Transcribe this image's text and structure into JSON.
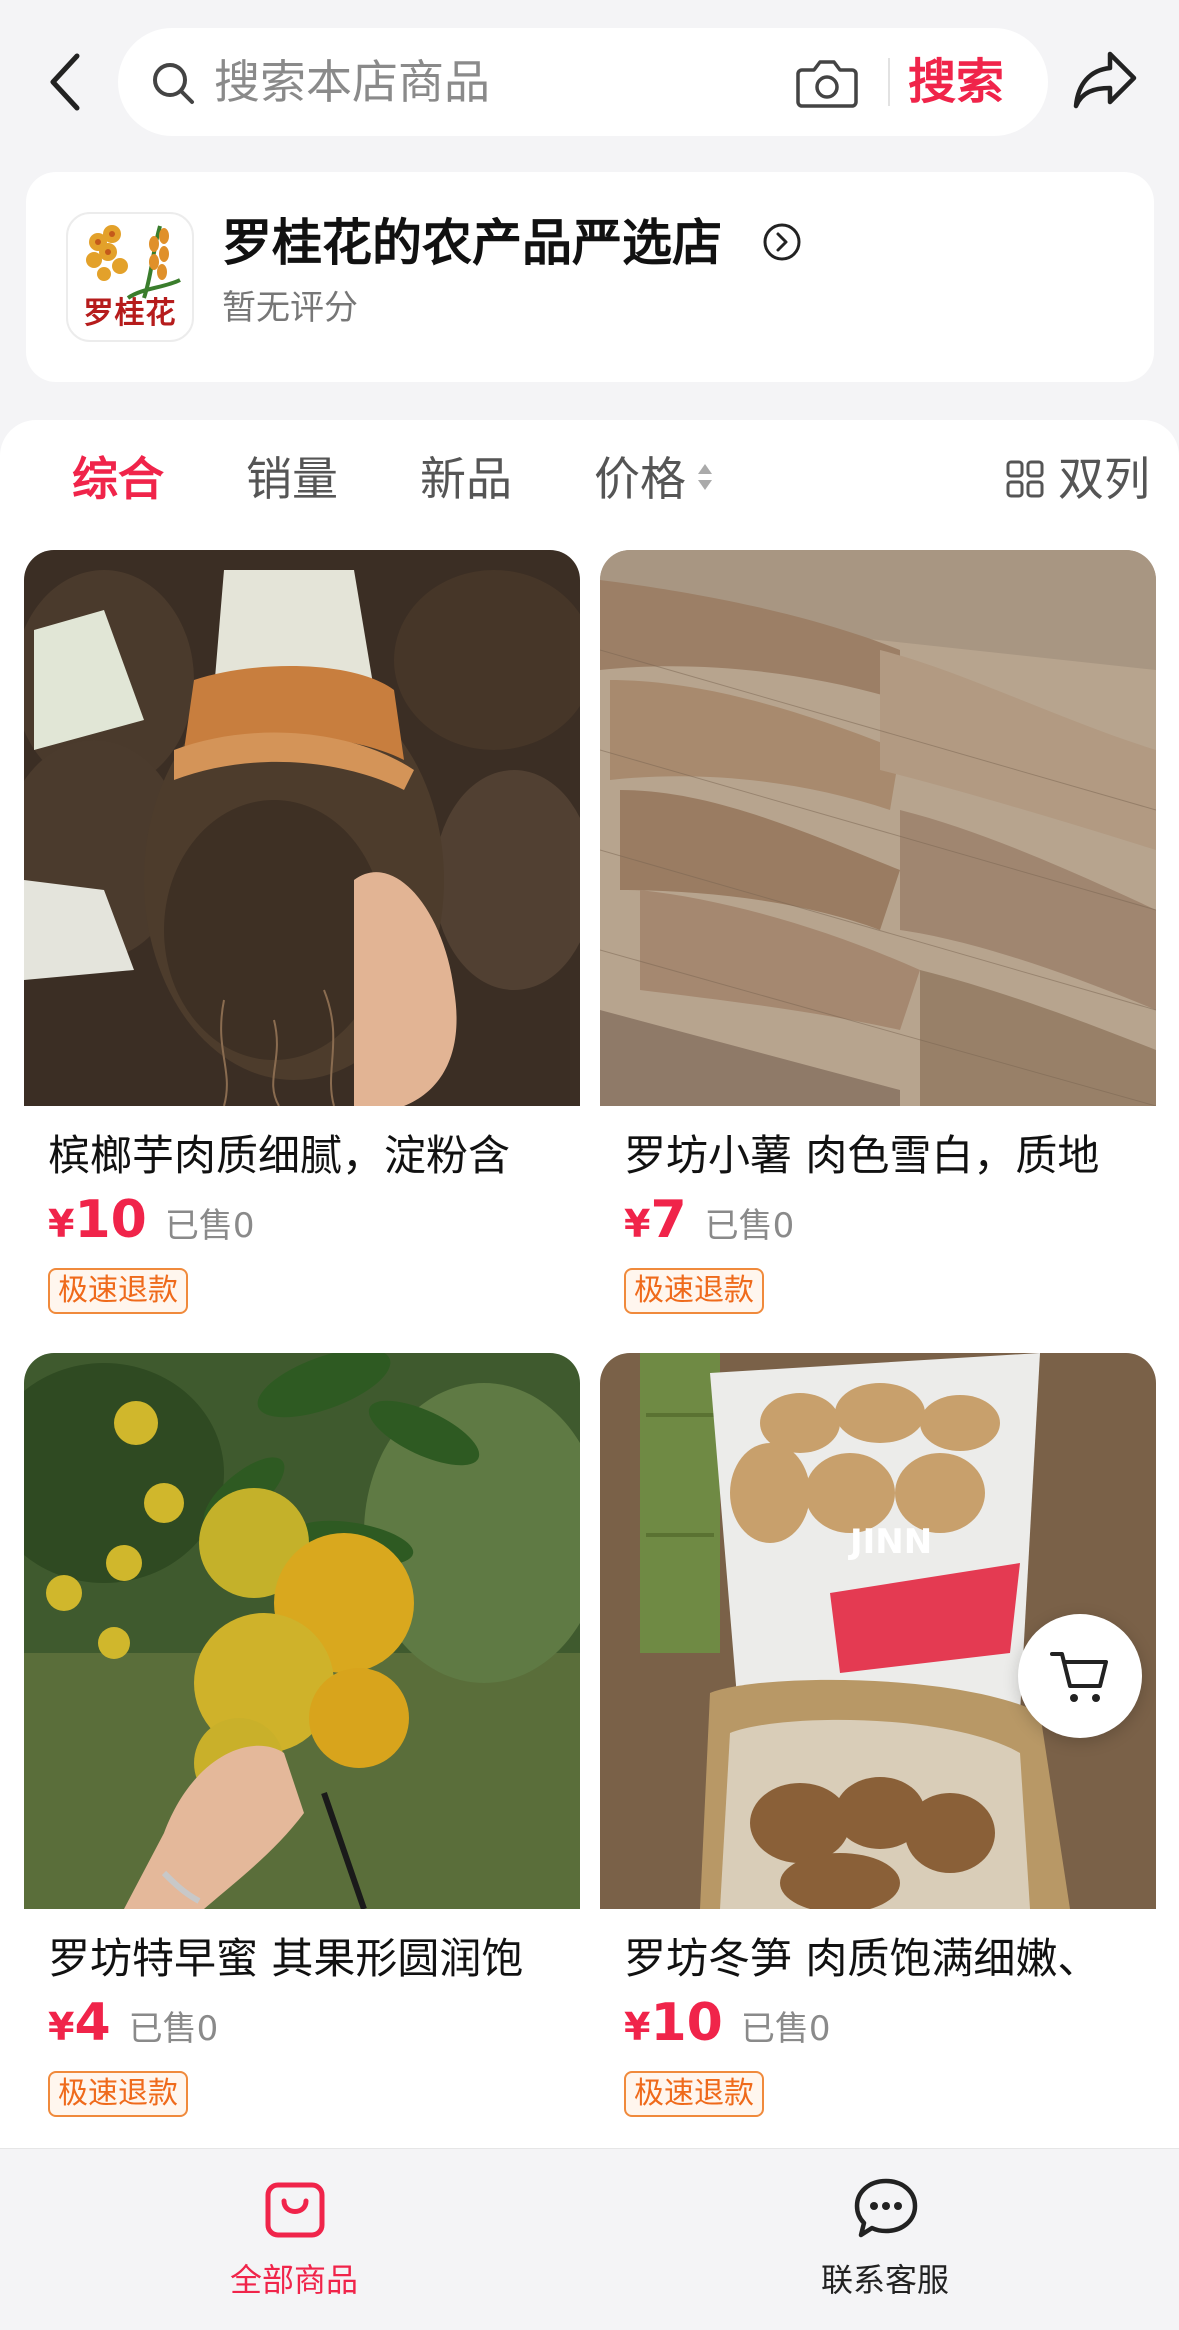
{
  "search": {
    "placeholder": "搜索本店商品",
    "button_label": "搜索"
  },
  "shop": {
    "name": "罗桂花的农产品严选店",
    "rating": "暂无评分",
    "logo_text": "罗桂花"
  },
  "sort_tabs": [
    {
      "label": "综合",
      "active": true
    },
    {
      "label": "销量",
      "active": false
    },
    {
      "label": "新品",
      "active": false
    },
    {
      "label": "价格",
      "active": false
    }
  ],
  "layout_toggle": {
    "label": "双列",
    "icon": "grid-icon"
  },
  "products": [
    {
      "title": "槟榔芋肉质细腻，淀粉含",
      "price_symbol": "¥",
      "price": "10",
      "sold": "已售0",
      "badge": "极速退款"
    },
    {
      "title": "罗坊小薯  肉色雪白，质地",
      "price_symbol": "¥",
      "price": "7",
      "sold": "已售0",
      "badge": "极速退款"
    },
    {
      "title": "罗坊特早蜜  其果形圆润饱",
      "price_symbol": "¥",
      "price": "4",
      "sold": "已售0",
      "badge": "极速退款"
    },
    {
      "title": "罗坊冬笋  肉质饱满细嫩、",
      "price_symbol": "¥",
      "price": "10",
      "sold": "已售0",
      "badge": "极速退款"
    }
  ],
  "bottom_nav": [
    {
      "label": "全部商品",
      "icon": "bag-icon",
      "active": true
    },
    {
      "label": "联系客服",
      "icon": "chat-icon",
      "active": false
    }
  ],
  "colors": {
    "accent": "#f0244a",
    "badge_orange": "#ef6a1b",
    "background": "#f4f4f6"
  }
}
